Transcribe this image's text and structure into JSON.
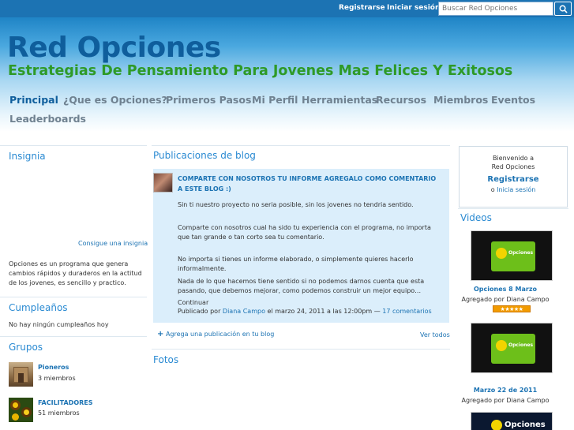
{
  "topbar": {
    "register": "Registrarse",
    "login": "Iniciar sesión",
    "search_placeholder": "Buscar Red Opciones"
  },
  "header": {
    "title": "Red Opciones",
    "tagline": "Estrategias De Pensamiento Para Jovenes Mas Felices Y Exitosos"
  },
  "nav": {
    "items": [
      "Principal",
      "¿Que es Opciones?",
      "Primeros Pasos",
      "Mi Perfil",
      "Herramientas",
      "Recursos",
      "Miembros",
      "Eventos",
      "Leaderboards"
    ]
  },
  "left": {
    "badge_title": "Insignia",
    "badge_link": "Consigue una insignia",
    "badge_text": "Opciones es un programa que genera cambios rápidos y duraderos en la actitud de los jovenes, es sencillo y practico.",
    "birthdays_title": "Cumpleaños",
    "birthdays_empty": "No hay ningún cumpleaños hoy",
    "groups_title": "Grupos",
    "groups": [
      {
        "name": "Pioneros",
        "members": "3 miembros"
      },
      {
        "name": "FACILITADORES",
        "members": "51 miembros"
      }
    ]
  },
  "center": {
    "blog_title": "Publicaciones de blog",
    "post": {
      "title": "COMPARTE CON NOSOTROS TU INFORME AGREGALO COMO COMENTARIO A ESTE BLOG :)",
      "p1": "Sin ti nuestro proyecto no seria posible, sin los jovenes no tendria sentido.",
      "p2": "Comparte con nosotros cual ha sido tu experiencia con el programa, no importa que tan grande o tan corto sea tu comentario.",
      "p3": "No importa si tienes un informe elaborado, o simplemente quieres hacerlo informalmente.",
      "p4": "Nada de lo que hacemos tiene sentido si no podemos darnos cuenta que esta pasando, que debemos mejorar, como podemos construir un mejor equipo…",
      "continue": "Continuar",
      "meta_prefix": "Publicado por",
      "author": "Diana Campo",
      "meta_suffix": "el marzo 24, 2011 a las 12:00pm —",
      "comments": "17 comentarios"
    },
    "add_post": "Agrega una publicación en tu blog",
    "see_all": "Ver todos",
    "photos_title": "Fotos"
  },
  "right": {
    "welcome_line1": "Bienvenido a",
    "welcome_line2": "Red Opciones",
    "register": "Registrarse",
    "or": "o",
    "login": "Inicia sesión",
    "videos_title": "Videos",
    "videos": [
      {
        "title": "Opciones 8 Marzo",
        "added_by": "Agregado por Diana Campo",
        "rating": 5
      },
      {
        "title": "Marzo 22 de 2011",
        "added_by": "Agregado por Diana Campo",
        "rating": 0
      }
    ],
    "thumb_caption": "Opciones"
  }
}
